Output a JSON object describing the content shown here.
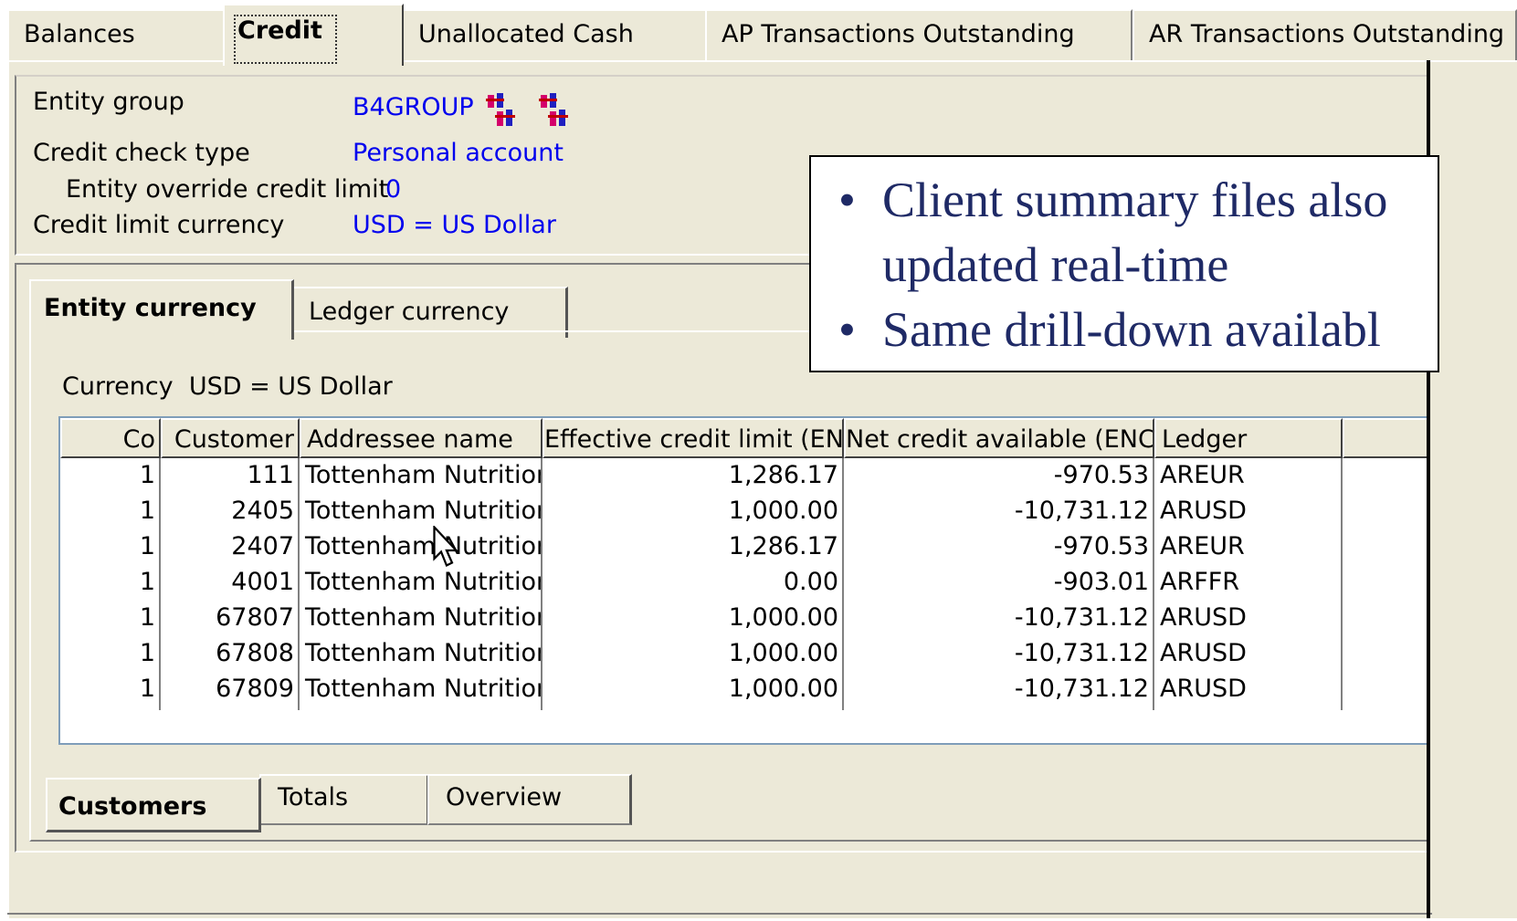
{
  "top_tabs": [
    {
      "label": "Balances",
      "active": false
    },
    {
      "label": "Credit",
      "active": true
    },
    {
      "label": "Unallocated Cash",
      "active": false
    },
    {
      "label": "AP Transactions Outstanding",
      "active": false
    },
    {
      "label": "AR Transactions Outstanding",
      "active": false
    }
  ],
  "header": {
    "entity_group_label": "Entity group",
    "entity_group_value": "B4GROUP",
    "credit_check_type_label": "Credit check type",
    "credit_check_type_value": "Personal account",
    "override_limit_label": "Entity override credit limit",
    "override_limit_value": "0",
    "credit_limit_currency_label": "Credit limit currency",
    "credit_limit_currency_value": "USD = US Dollar",
    "icons": [
      "group-icon",
      "group-icon"
    ]
  },
  "currency_tabs": [
    {
      "label": "Entity currency",
      "active": true
    },
    {
      "label": "Ledger currency",
      "active": false
    }
  ],
  "currency_line": {
    "label": "Currency",
    "value": "USD = US Dollar"
  },
  "grid": {
    "columns": [
      "Co",
      "Customer",
      "Addressee name",
      "Effective credit limit (ENC)",
      "Net credit available (ENC)",
      "Ledger"
    ],
    "rows": [
      [
        "1",
        "111",
        "Tottenham Nutrition",
        "1,286.17",
        "-970.53",
        "AREUR"
      ],
      [
        "1",
        "2405",
        "Tottenham Nutrition",
        "1,000.00",
        "-10,731.12",
        "ARUSD"
      ],
      [
        "1",
        "2407",
        "Tottenham Nutrition",
        "1,286.17",
        "-970.53",
        "AREUR"
      ],
      [
        "1",
        "4001",
        "Tottenham Nutrition",
        "0.00",
        "-903.01",
        "ARFFR"
      ],
      [
        "1",
        "67807",
        "Tottenham Nutrition",
        "1,000.00",
        "-10,731.12",
        "ARUSD"
      ],
      [
        "1",
        "67808",
        "Tottenham Nutrition",
        "1,000.00",
        "-10,731.12",
        "ARUSD"
      ],
      [
        "1",
        "67809",
        "Tottenham Nutrition",
        "1,000.00",
        "-10,731.12",
        "ARUSD"
      ]
    ]
  },
  "bottom_tabs": [
    {
      "label": "Customers",
      "active": true
    },
    {
      "label": "Totals",
      "active": false
    },
    {
      "label": "Overview",
      "active": false
    }
  ],
  "callout": {
    "bullets": [
      "Client summary files also",
      "updated real-time",
      "Same drill-down availabl"
    ]
  },
  "colors": {
    "value_text": "#0000ee",
    "callout_text": "#1f2a66",
    "face": "#ece9d8"
  }
}
